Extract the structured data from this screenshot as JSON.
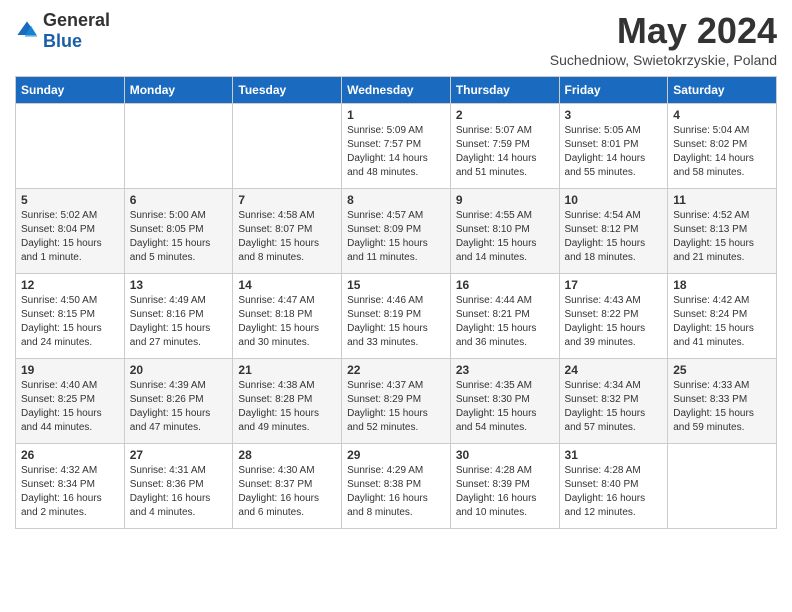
{
  "logo": {
    "general": "General",
    "blue": "Blue"
  },
  "title": "May 2024",
  "location": "Suchedniow, Swietokrzyskie, Poland",
  "headers": [
    "Sunday",
    "Monday",
    "Tuesday",
    "Wednesday",
    "Thursday",
    "Friday",
    "Saturday"
  ],
  "weeks": [
    [
      {
        "day": "",
        "info": ""
      },
      {
        "day": "",
        "info": ""
      },
      {
        "day": "",
        "info": ""
      },
      {
        "day": "1",
        "info": "Sunrise: 5:09 AM\nSunset: 7:57 PM\nDaylight: 14 hours\nand 48 minutes."
      },
      {
        "day": "2",
        "info": "Sunrise: 5:07 AM\nSunset: 7:59 PM\nDaylight: 14 hours\nand 51 minutes."
      },
      {
        "day": "3",
        "info": "Sunrise: 5:05 AM\nSunset: 8:01 PM\nDaylight: 14 hours\nand 55 minutes."
      },
      {
        "day": "4",
        "info": "Sunrise: 5:04 AM\nSunset: 8:02 PM\nDaylight: 14 hours\nand 58 minutes."
      }
    ],
    [
      {
        "day": "5",
        "info": "Sunrise: 5:02 AM\nSunset: 8:04 PM\nDaylight: 15 hours\nand 1 minute."
      },
      {
        "day": "6",
        "info": "Sunrise: 5:00 AM\nSunset: 8:05 PM\nDaylight: 15 hours\nand 5 minutes."
      },
      {
        "day": "7",
        "info": "Sunrise: 4:58 AM\nSunset: 8:07 PM\nDaylight: 15 hours\nand 8 minutes."
      },
      {
        "day": "8",
        "info": "Sunrise: 4:57 AM\nSunset: 8:09 PM\nDaylight: 15 hours\nand 11 minutes."
      },
      {
        "day": "9",
        "info": "Sunrise: 4:55 AM\nSunset: 8:10 PM\nDaylight: 15 hours\nand 14 minutes."
      },
      {
        "day": "10",
        "info": "Sunrise: 4:54 AM\nSunset: 8:12 PM\nDaylight: 15 hours\nand 18 minutes."
      },
      {
        "day": "11",
        "info": "Sunrise: 4:52 AM\nSunset: 8:13 PM\nDaylight: 15 hours\nand 21 minutes."
      }
    ],
    [
      {
        "day": "12",
        "info": "Sunrise: 4:50 AM\nSunset: 8:15 PM\nDaylight: 15 hours\nand 24 minutes."
      },
      {
        "day": "13",
        "info": "Sunrise: 4:49 AM\nSunset: 8:16 PM\nDaylight: 15 hours\nand 27 minutes."
      },
      {
        "day": "14",
        "info": "Sunrise: 4:47 AM\nSunset: 8:18 PM\nDaylight: 15 hours\nand 30 minutes."
      },
      {
        "day": "15",
        "info": "Sunrise: 4:46 AM\nSunset: 8:19 PM\nDaylight: 15 hours\nand 33 minutes."
      },
      {
        "day": "16",
        "info": "Sunrise: 4:44 AM\nSunset: 8:21 PM\nDaylight: 15 hours\nand 36 minutes."
      },
      {
        "day": "17",
        "info": "Sunrise: 4:43 AM\nSunset: 8:22 PM\nDaylight: 15 hours\nand 39 minutes."
      },
      {
        "day": "18",
        "info": "Sunrise: 4:42 AM\nSunset: 8:24 PM\nDaylight: 15 hours\nand 41 minutes."
      }
    ],
    [
      {
        "day": "19",
        "info": "Sunrise: 4:40 AM\nSunset: 8:25 PM\nDaylight: 15 hours\nand 44 minutes."
      },
      {
        "day": "20",
        "info": "Sunrise: 4:39 AM\nSunset: 8:26 PM\nDaylight: 15 hours\nand 47 minutes."
      },
      {
        "day": "21",
        "info": "Sunrise: 4:38 AM\nSunset: 8:28 PM\nDaylight: 15 hours\nand 49 minutes."
      },
      {
        "day": "22",
        "info": "Sunrise: 4:37 AM\nSunset: 8:29 PM\nDaylight: 15 hours\nand 52 minutes."
      },
      {
        "day": "23",
        "info": "Sunrise: 4:35 AM\nSunset: 8:30 PM\nDaylight: 15 hours\nand 54 minutes."
      },
      {
        "day": "24",
        "info": "Sunrise: 4:34 AM\nSunset: 8:32 PM\nDaylight: 15 hours\nand 57 minutes."
      },
      {
        "day": "25",
        "info": "Sunrise: 4:33 AM\nSunset: 8:33 PM\nDaylight: 15 hours\nand 59 minutes."
      }
    ],
    [
      {
        "day": "26",
        "info": "Sunrise: 4:32 AM\nSunset: 8:34 PM\nDaylight: 16 hours\nand 2 minutes."
      },
      {
        "day": "27",
        "info": "Sunrise: 4:31 AM\nSunset: 8:36 PM\nDaylight: 16 hours\nand 4 minutes."
      },
      {
        "day": "28",
        "info": "Sunrise: 4:30 AM\nSunset: 8:37 PM\nDaylight: 16 hours\nand 6 minutes."
      },
      {
        "day": "29",
        "info": "Sunrise: 4:29 AM\nSunset: 8:38 PM\nDaylight: 16 hours\nand 8 minutes."
      },
      {
        "day": "30",
        "info": "Sunrise: 4:28 AM\nSunset: 8:39 PM\nDaylight: 16 hours\nand 10 minutes."
      },
      {
        "day": "31",
        "info": "Sunrise: 4:28 AM\nSunset: 8:40 PM\nDaylight: 16 hours\nand 12 minutes."
      },
      {
        "day": "",
        "info": ""
      }
    ]
  ]
}
